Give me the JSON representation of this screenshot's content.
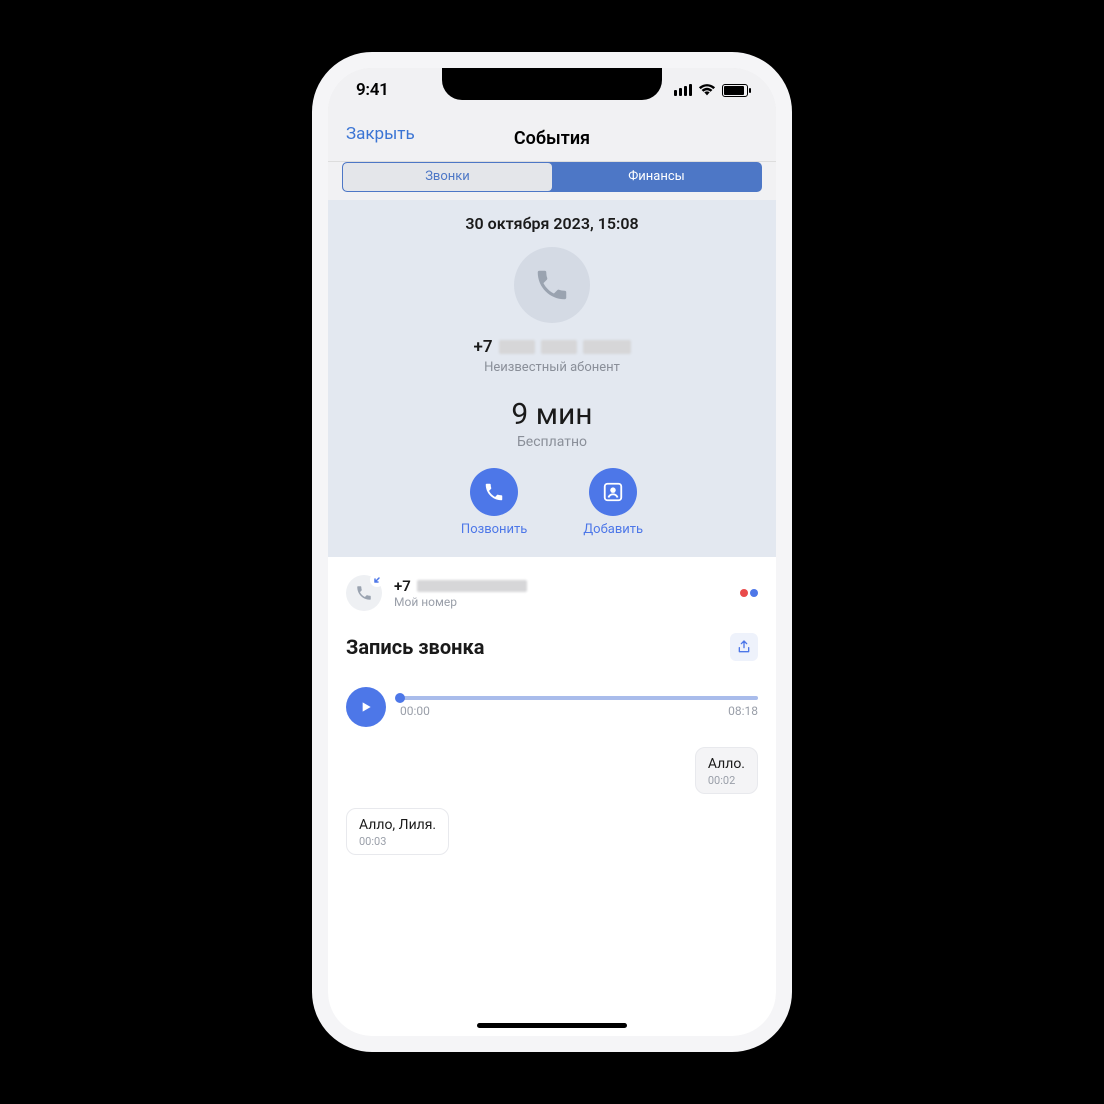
{
  "status": {
    "time": "9:41"
  },
  "header": {
    "close": "Закрыть",
    "title": "События"
  },
  "tabs": {
    "calls": "Звонки",
    "finance": "Финансы"
  },
  "event": {
    "datetime": "30 октября 2023, 15:08",
    "caller_prefix": "+7",
    "caller_sub": "Неизвестный абонент",
    "duration": "9 мин",
    "duration_sub": "Бесплатно"
  },
  "actions": {
    "call": "Позвонить",
    "add": "Добавить"
  },
  "my": {
    "prefix": "+7",
    "sub": "Мой номер"
  },
  "recording": {
    "title": "Запись звонка",
    "start": "00:00",
    "end": "08:18"
  },
  "transcript": [
    {
      "side": "right",
      "text": "Алло.",
      "time": "00:02"
    },
    {
      "side": "left",
      "text": "Алло, Лиля.",
      "time": "00:03"
    }
  ],
  "colors": {
    "accent": "#4d77e8",
    "seg_bg": "#4d77c6"
  }
}
